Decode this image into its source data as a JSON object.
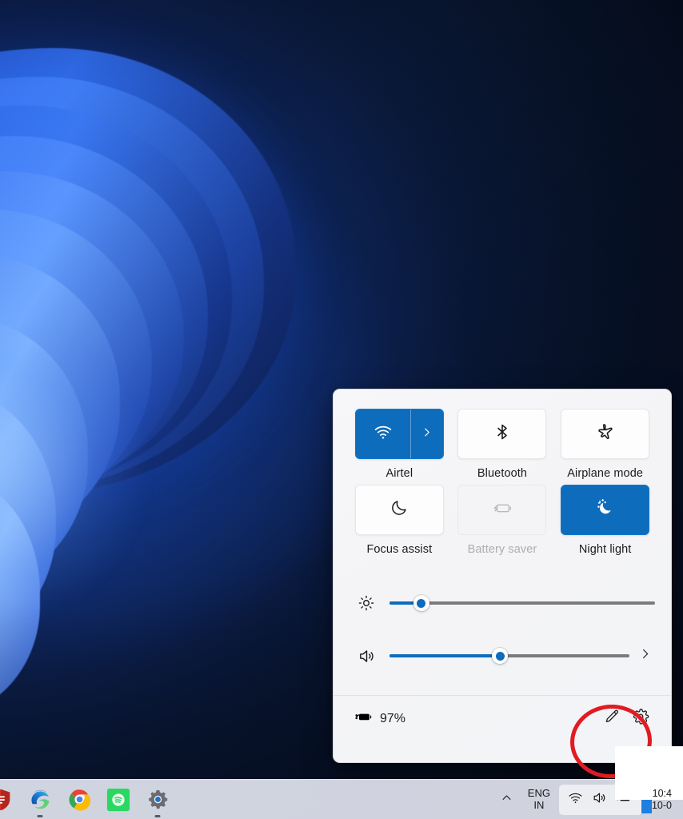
{
  "desktop": {
    "wallpaper_name": "windows-11-bloom-wallpaper",
    "background_color": "#07142c"
  },
  "quick_settings": {
    "panel_name": "Quick Settings",
    "background_color": "#f4f4f6",
    "accent_color": "#0e6cbd",
    "tiles": [
      {
        "id": "wifi",
        "label": "Airtel",
        "icon": "wifi-icon",
        "state": "active",
        "has_chevron": true,
        "chevron_icon": "chevron-right-icon"
      },
      {
        "id": "bluetooth",
        "label": "Bluetooth",
        "icon": "bluetooth-icon",
        "state": "inactive",
        "has_chevron": false
      },
      {
        "id": "airplane-mode",
        "label": "Airplane mode",
        "icon": "airplane-icon",
        "state": "inactive",
        "has_chevron": false
      },
      {
        "id": "focus-assist",
        "label": "Focus assist",
        "icon": "moon-icon",
        "state": "inactive",
        "has_chevron": false
      },
      {
        "id": "battery-saver",
        "label": "Battery saver",
        "icon": "battery-saver-icon",
        "state": "disabled",
        "has_chevron": false
      },
      {
        "id": "night-light",
        "label": "Night light",
        "icon": "night-light-icon",
        "state": "active",
        "has_chevron": false
      }
    ],
    "sliders": [
      {
        "id": "brightness",
        "icon": "brightness-icon",
        "value": 12,
        "min": 0,
        "max": 100,
        "has_chevron": false
      },
      {
        "id": "volume",
        "icon": "volume-icon",
        "value": 46,
        "min": 0,
        "max": 100,
        "has_chevron": true,
        "chevron_icon": "chevron-right-icon"
      }
    ],
    "footer": {
      "battery_icon": "battery-charging-icon",
      "battery_percent": "97%",
      "edit_icon": "pencil-icon",
      "settings_icon": "gear-icon"
    }
  },
  "annotation": {
    "shape": "ellipse",
    "color": "#e01b22",
    "target": "pencil-icon"
  },
  "taskbar": {
    "background_color": "#e0e3ee",
    "apps": [
      {
        "id": "app-partial-left",
        "icon": "shield-app-icon",
        "running": false
      },
      {
        "id": "microsoft-edge",
        "icon": "edge-icon",
        "running": true
      },
      {
        "id": "google-chrome",
        "icon": "chrome-icon",
        "running": false
      },
      {
        "id": "spotify",
        "icon": "spotify-icon",
        "running": false
      },
      {
        "id": "settings",
        "icon": "gear-icon",
        "running": true
      }
    ],
    "tray": {
      "overflow_icon": "chevron-up-icon",
      "language_line1": "ENG",
      "language_line2": "IN",
      "status_icons": [
        "wifi-icon",
        "volume-icon",
        "battery-charging-icon"
      ],
      "clock_time": "10:4",
      "clock_date": "10-0"
    }
  }
}
